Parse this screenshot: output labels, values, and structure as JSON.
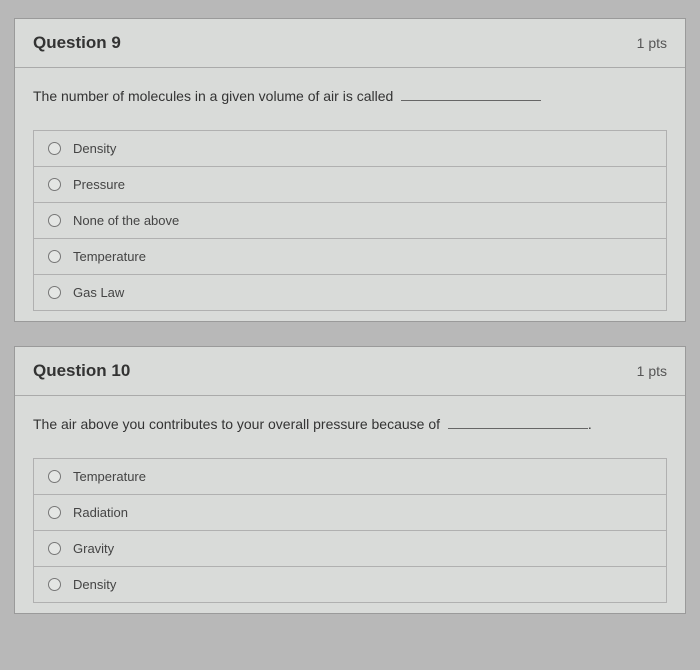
{
  "questions": [
    {
      "number": "Question 9",
      "points": "1 pts",
      "prompt": "The number of molecules in a given volume of air is called",
      "options": [
        {
          "label": "Density"
        },
        {
          "label": "Pressure"
        },
        {
          "label": "None of the above"
        },
        {
          "label": "Temperature"
        },
        {
          "label": "Gas Law"
        }
      ]
    },
    {
      "number": "Question 10",
      "points": "1 pts",
      "prompt": "The air above you contributes to your overall pressure because of",
      "options": [
        {
          "label": "Temperature"
        },
        {
          "label": "Radiation"
        },
        {
          "label": "Gravity"
        },
        {
          "label": "Density"
        }
      ]
    }
  ]
}
